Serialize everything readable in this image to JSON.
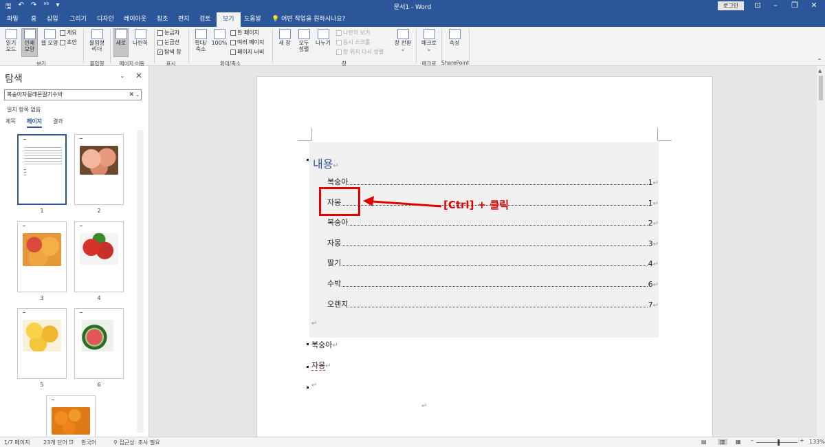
{
  "titlebar": {
    "qat_icons": [
      "save-icon",
      "undo-icon",
      "redo-icon",
      "spelling-icon",
      "customize-icon"
    ],
    "title": "문서1  -  Word",
    "login": "로그인",
    "window_controls": [
      "ribbon-display-icon",
      "minimize-icon",
      "restore-icon",
      "close-icon"
    ]
  },
  "tabs": [
    "파일",
    "홈",
    "삽입",
    "그리기",
    "디자인",
    "레이아웃",
    "참조",
    "편지",
    "검토",
    "보기",
    "도움말"
  ],
  "active_tab": "보기",
  "tell_me": "어떤 작업을 원하시나요?",
  "ribbon": {
    "read_mode": "읽기\n모드",
    "print_layout": "인쇄\n모양",
    "web_layout": "웹 모양",
    "outline": "개요",
    "draft": "초안",
    "group_views": "보기",
    "immersive_reader": "몰입형\n리더",
    "group_immersive": "몰입형",
    "vertical": "세로",
    "side_to_side": "나란히",
    "group_page_move": "페이지 이동",
    "ruler": "눈금자",
    "gridlines": "눈금선",
    "nav_pane": "탐색 창",
    "group_show": "표시",
    "zoom": "확대/\n축소",
    "zoom_100": "100%",
    "one_page": "한 페이지",
    "multiple_pages": "여러 페이지",
    "page_width": "페이지 너비",
    "group_zoom": "확대/축소",
    "new_window": "새 창",
    "arrange_all": "모두\n정렬",
    "split": "나누기",
    "view_side_by_side": "나란히 보기",
    "sync_scroll": "동시 스크롤",
    "reset_position": "창 위치 다시 정렬",
    "switch_windows": "창 전환",
    "group_window": "창",
    "macros": "매크로",
    "group_macros": "매크로",
    "properties": "속성",
    "group_sharepoint": "SharePoint"
  },
  "nav": {
    "title": "탐색",
    "search_value": "복숭아자몽레몬딸기수박",
    "no_match": "일치 항목 없음",
    "tabs": [
      "제목",
      "페이지",
      "결과"
    ],
    "active_tab": "페이지",
    "page_labels": [
      "1",
      "2",
      "3",
      "4",
      "5",
      "6"
    ],
    "thumb_colors": [
      "#ffffff",
      "#e9a48a",
      "#f0a640",
      "#c83a2e",
      "#f5c53a",
      "#c8454a",
      "#f08a20"
    ]
  },
  "document": {
    "toc_heading": "내용",
    "toc_entries": [
      {
        "text": "복숭아",
        "page": "1"
      },
      {
        "text": "자몽",
        "page": "1"
      },
      {
        "text": "복숭아",
        "page": "2"
      },
      {
        "text": "자몽",
        "page": "3"
      },
      {
        "text": "딸기",
        "page": "4"
      },
      {
        "text": "수박",
        "page": "6"
      },
      {
        "text": "오렌지",
        "page": "7"
      }
    ],
    "paragraph_mark": "↵",
    "body_lines": [
      "복숭아",
      "자몽"
    ],
    "annotation": "[Ctrl]  +  클릭",
    "annotation_color": "#e00000"
  },
  "status": {
    "page": "1/7 페이지",
    "words": "23개 단어",
    "language": "한국어",
    "accessibility": "접근성: 조사 필요",
    "zoom": "133%"
  }
}
